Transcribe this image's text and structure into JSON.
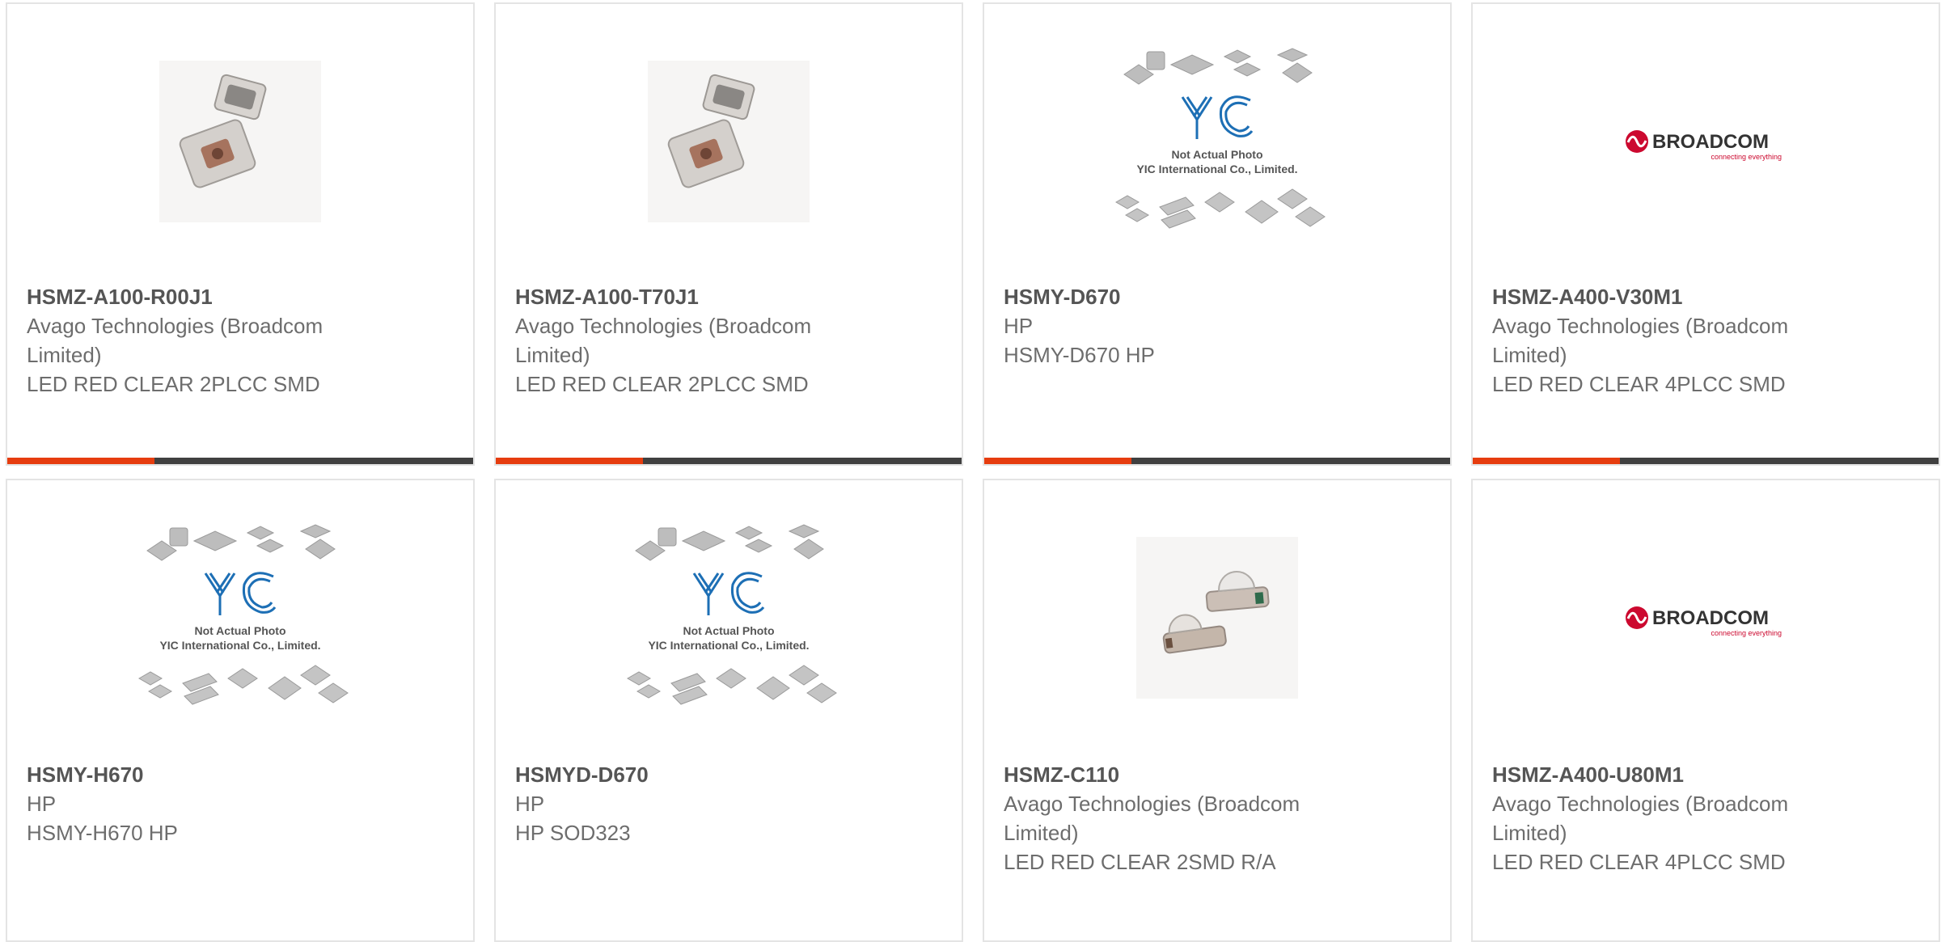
{
  "products": [
    {
      "part": "HSMZ-A100-R00J1",
      "manufacturer": "Avago Technologies (Broadcom Limited)",
      "description": "LED RED CLEAR 2PLCC SMD",
      "image": "led-2plcc-photo"
    },
    {
      "part": "HSMZ-A100-T70J1",
      "manufacturer": "Avago Technologies (Broadcom Limited)",
      "description": "LED RED CLEAR 2PLCC SMD",
      "image": "led-2plcc-photo"
    },
    {
      "part": "HSMY-D670",
      "manufacturer": "HP",
      "description": "HSMY-D670 HP",
      "image": "yic-placeholder"
    },
    {
      "part": "HSMZ-A400-V30M1",
      "manufacturer": "Avago Technologies (Broadcom Limited)",
      "description": "LED RED CLEAR 4PLCC SMD",
      "image": "broadcom-logo"
    },
    {
      "part": "HSMY-H670",
      "manufacturer": "HP",
      "description": "HSMY-H670 HP",
      "image": "yic-placeholder"
    },
    {
      "part": "HSMYD-D670",
      "manufacturer": "HP",
      "description": "HP SOD323",
      "image": "yic-placeholder"
    },
    {
      "part": "HSMZ-C110",
      "manufacturer": "Avago Technologies (Broadcom Limited)",
      "description": "LED RED CLEAR 2SMD R/A",
      "image": "led-side-photo"
    },
    {
      "part": "HSMZ-A400-U80M1",
      "manufacturer": "Avago Technologies (Broadcom Limited)",
      "description": "LED RED CLEAR 4PLCC SMD",
      "image": "broadcom-logo"
    }
  ],
  "placeholder": {
    "line1": "Not Actual Photo",
    "line2": "YIC International Co., Limited.",
    "mark": "YIC"
  },
  "logo": {
    "name": "BROADCOM",
    "tagline": "connecting everything"
  },
  "colors": {
    "accent": "#e63d0f",
    "bar": "#404040",
    "broadcom": "#cc092f",
    "yic": "#1d6fb5"
  }
}
